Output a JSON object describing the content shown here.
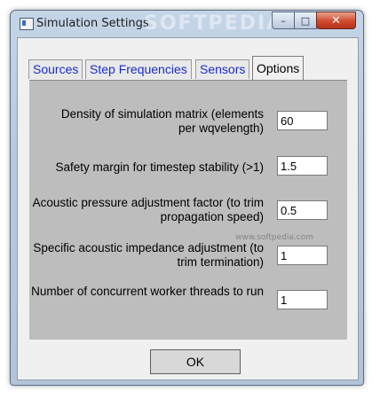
{
  "window": {
    "title": "Simulation Settings",
    "watermark": "SOFTPEDIA",
    "controls": {
      "minimize": "–",
      "maximize": "□",
      "close": "✕"
    }
  },
  "tabs": [
    {
      "label": "Sources",
      "active": false
    },
    {
      "label": "Step Frequencies",
      "active": false
    },
    {
      "label": "Sensors",
      "active": false
    },
    {
      "label": "Options",
      "active": true
    }
  ],
  "options": [
    {
      "label": "Density of simulation matrix (elements per wqvelength)",
      "value": "60"
    },
    {
      "label": "Safety margin for timestep stability (>1)",
      "value": "1.5"
    },
    {
      "label": "Acoustic pressure adjustment factor (to trim propagation speed)",
      "value": "0.5"
    },
    {
      "label": "Specific acoustic impedance adjustment (to trim termination)",
      "value": "1"
    },
    {
      "label": "Number of concurrent worker threads to run",
      "value": "1"
    }
  ],
  "softpedia_url": "www.softpedia.com",
  "ok_label": "OK"
}
